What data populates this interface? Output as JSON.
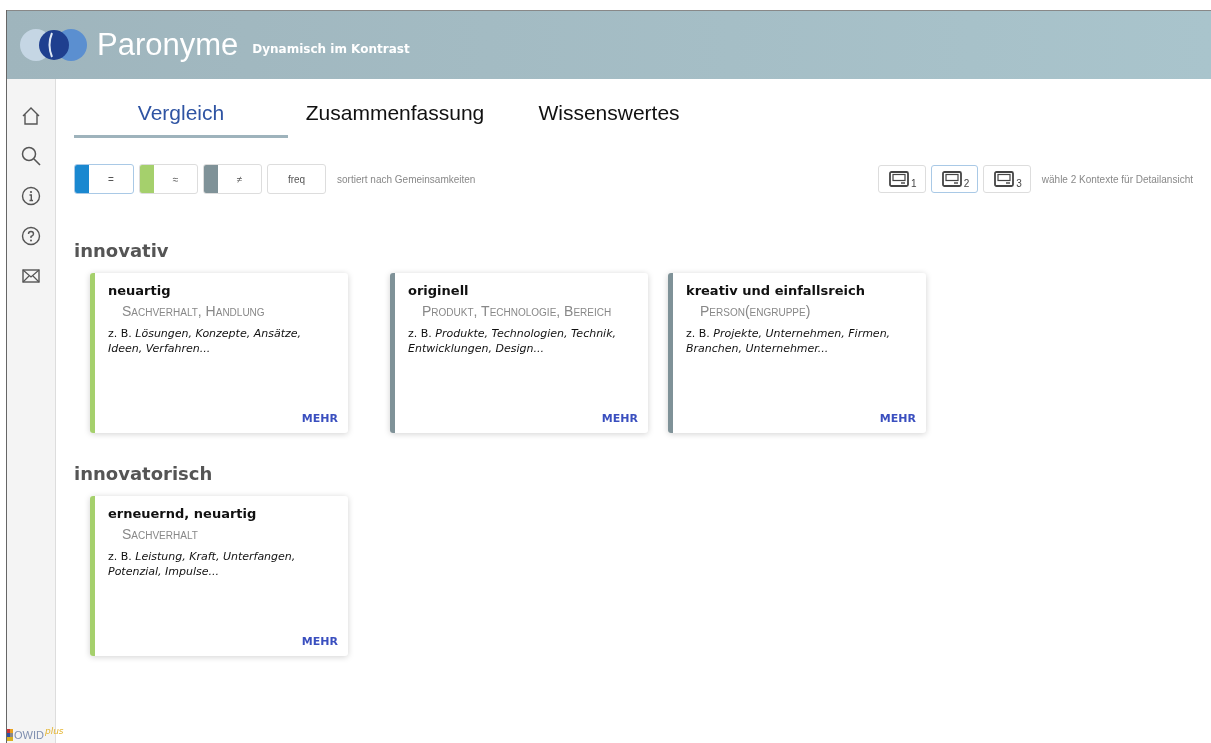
{
  "header": {
    "title": "Paronyme",
    "subtitle": "Dynamisch im Kontrast"
  },
  "sidebar": {
    "items": [
      {
        "kind": "home"
      },
      {
        "kind": "search"
      },
      {
        "kind": "info"
      },
      {
        "kind": "help"
      },
      {
        "kind": "mail"
      }
    ]
  },
  "tabs": [
    {
      "label": "Vergleich",
      "selected": true
    },
    {
      "label": "Zusammenfassung",
      "selected": false
    },
    {
      "label": "Wissenswertes",
      "selected": false
    }
  ],
  "filters": [
    {
      "label": "=",
      "color": "#1a88d0",
      "selected": true
    },
    {
      "label": "≈",
      "color": "#a5d06c",
      "selected": false
    },
    {
      "label": "≠",
      "color": "#7f9298",
      "selected": false
    },
    {
      "label": "freq",
      "selected": false
    }
  ],
  "sort_hint": "sortiert nach Gemeinsamkeiten",
  "contexts": [
    {
      "label": "1",
      "selected": false
    },
    {
      "label": "2",
      "selected": true
    },
    {
      "label": "3",
      "selected": false
    }
  ],
  "context_hint": "wähle 2 Kontexte für Detailansicht",
  "sections": [
    {
      "heading": "innovativ",
      "cards": [
        {
          "title": "neuartig",
          "category": "Sachverhalt, Handlung",
          "examples": "z. B. *Lösungen, Konzepte, Ansätze, Ideen, Verfahren...*",
          "link": "MEHR",
          "color": "#a5d06c"
        },
        {
          "title": "originell",
          "category": "Produkt, Technologie, Bereich",
          "examples": "z. B. *Produkte, Technologien, Technik, Entwicklungen, Design...*",
          "link": "MEHR",
          "color": "#7f9298"
        },
        {
          "title": "kreativ und einfallsreich",
          "category": "Person(engruppe)",
          "examples": "z. B. *Projekte, Unternehmen, Firmen, Branchen, Unternehmer...*",
          "link": "MEHR",
          "color": "#7f9298"
        }
      ]
    },
    {
      "heading": "innovatorisch",
      "cards": [
        {
          "title": "erneuernd, neuartig",
          "category": "Sachverhalt",
          "examples": "z. B. *Leistung, Kraft, Unterfangen, Potenzial, Impulse...*",
          "link": "MEHR",
          "color": "#a5d06c"
        }
      ]
    }
  ],
  "footer_logo": {
    "name": "OWID",
    "suffix": "plus"
  }
}
